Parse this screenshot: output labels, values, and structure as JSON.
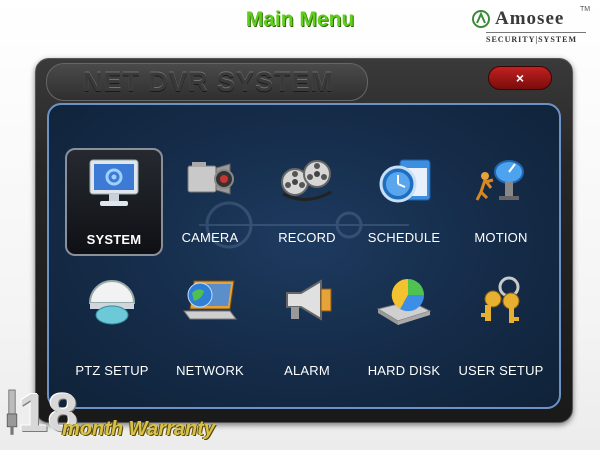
{
  "header": {
    "title": "Main Menu"
  },
  "brand": {
    "name": "Amosee",
    "trademark": "TM",
    "tagline": "SECURITY|SYSTEM"
  },
  "window": {
    "title": "NET DVR SYSTEM",
    "close_label": "×"
  },
  "menu": {
    "items": [
      {
        "label": "SYSTEM",
        "icon": "monitor-gear-icon",
        "selected": true
      },
      {
        "label": "CAMERA",
        "icon": "camera-icon"
      },
      {
        "label": "RECORD",
        "icon": "film-reel-icon"
      },
      {
        "label": "SCHEDULE",
        "icon": "clock-calendar-icon"
      },
      {
        "label": "MOTION",
        "icon": "motion-dish-icon"
      },
      {
        "label": "PTZ SETUP",
        "icon": "dome-camera-icon"
      },
      {
        "label": "NETWORK",
        "icon": "laptop-globe-icon"
      },
      {
        "label": "ALARM",
        "icon": "megaphone-icon"
      },
      {
        "label": "HARD DISK",
        "icon": "hard-disk-pie-icon"
      },
      {
        "label": "USER SETUP",
        "icon": "keys-icon"
      }
    ]
  },
  "warranty": {
    "number": "18",
    "text": "month Warranty"
  },
  "colors": {
    "accent_green": "#5fcf1a",
    "panel_blue": "#142a46",
    "border_blue": "#6b93c7",
    "close_red": "#c22020"
  }
}
